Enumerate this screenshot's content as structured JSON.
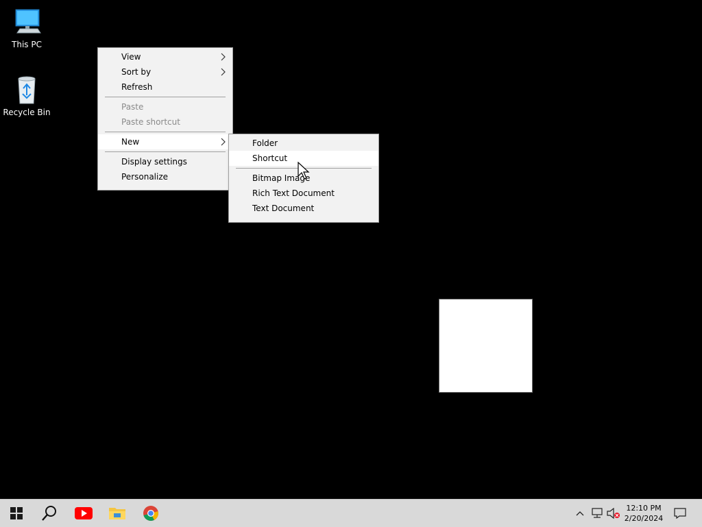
{
  "desktop": {
    "icons": [
      {
        "label": "This PC",
        "icon": "this-pc-icon"
      },
      {
        "label": "Recycle Bin",
        "icon": "recycle-bin-icon"
      }
    ]
  },
  "context_menu": {
    "view": "View",
    "sort_by": "Sort by",
    "refresh": "Refresh",
    "paste": "Paste",
    "paste_shortcut": "Paste shortcut",
    "new": "New",
    "display_settings": "Display settings",
    "personalize": "Personalize"
  },
  "new_submenu": {
    "folder": "Folder",
    "shortcut": "Shortcut",
    "bitmap_image": "Bitmap Image",
    "rich_text_document": "Rich Text Document",
    "text_document": "Text Document"
  },
  "taskbar": {
    "apps": [
      "windows-start-icon",
      "search-icon",
      "youtube-icon",
      "file-explorer-icon",
      "chrome-icon"
    ],
    "clock": {
      "time": "12:10 PM",
      "date": "2/20/2024"
    }
  },
  "colors": {
    "desktop_bg": "#000000",
    "menu_bg": "#f2f2f2",
    "taskbar_bg": "#d9d9d9",
    "youtube_red": "#ff0000",
    "windows_blue": "#0078d7"
  }
}
